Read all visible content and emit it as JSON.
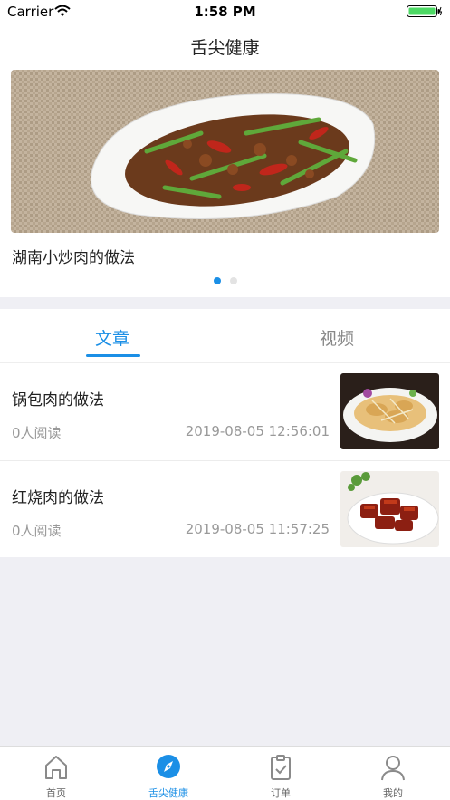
{
  "status_bar": {
    "carrier": "Carrier",
    "time": "1:58 PM"
  },
  "nav": {
    "title": "舌尖健康"
  },
  "banner": {
    "caption": "湖南小炒肉的做法",
    "page_count": 2,
    "active_index": 0
  },
  "tabs": [
    {
      "label": "文章",
      "active": true
    },
    {
      "label": "视频",
      "active": false
    }
  ],
  "articles": [
    {
      "title": "锅包肉的做法",
      "reads": "0人阅读",
      "date": "2019-08-05 12:56:01",
      "thumb_icon": "guobaorou-dish-photo"
    },
    {
      "title": "红烧肉的做法",
      "reads": "0人阅读",
      "date": "2019-08-05 11:57:25",
      "thumb_icon": "hongshaorou-dish-photo"
    }
  ],
  "tab_bar": [
    {
      "label": "首页",
      "icon": "home-icon",
      "active": false
    },
    {
      "label": "舌尖健康",
      "icon": "compass-icon",
      "active": true
    },
    {
      "label": "订单",
      "icon": "clipboard-icon",
      "active": false
    },
    {
      "label": "我的",
      "icon": "person-icon",
      "active": false
    }
  ],
  "colors": {
    "accent": "#1b8fe6",
    "background": "#efeff4",
    "battery": "#4cd964"
  }
}
